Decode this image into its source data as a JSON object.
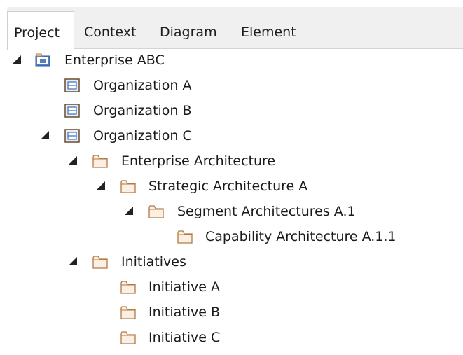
{
  "tabs": [
    {
      "label": "Project"
    },
    {
      "label": "Context"
    },
    {
      "label": "Diagram"
    },
    {
      "label": "Element"
    }
  ],
  "active_tab": "Project",
  "tree": {
    "root": "Enterprise ABC",
    "org_a": "Organization A",
    "org_b": "Organization B",
    "org_c": "Organization C",
    "enterprise_architecture": "Enterprise Architecture",
    "strategic_a": "Strategic Architecture A",
    "segment_a1": "Segment Architectures A.1",
    "capability_a11": "Capability Architecture A.1.1",
    "initiatives": "Initiatives",
    "initiative_a": "Initiative A",
    "initiative_b": "Initiative B",
    "initiative_c": "Initiative C"
  },
  "icons": {
    "root": "model-package-icon",
    "organization": "organization-element-icon",
    "folder": "folder-icon",
    "expanded": "expanded-triangle-icon"
  },
  "colors": {
    "tab_bar": "#f0f0f0",
    "folder_fill": "#fbefe4",
    "folder_stroke": "#b37a45",
    "org_fill": "#e7effc",
    "org_stroke": "#6a4a2a",
    "root_fill": "#4f7fc4"
  }
}
